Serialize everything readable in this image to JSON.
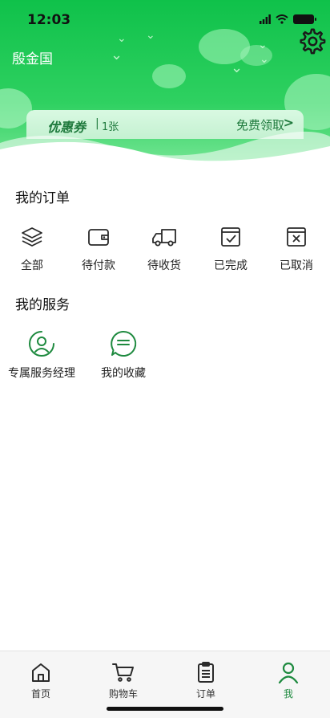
{
  "status_bar": {
    "time": "12:03"
  },
  "header": {
    "username": "殷金国",
    "settings_icon": "gear-icon"
  },
  "coupon": {
    "title": "优惠券",
    "separator": "|",
    "count": "1张",
    "action": "免费领取"
  },
  "orders": {
    "title": "我的订单",
    "items": [
      {
        "label": "全部",
        "icon": "layers-icon"
      },
      {
        "label": "待付款",
        "icon": "wallet-icon"
      },
      {
        "label": "待收货",
        "icon": "truck-icon"
      },
      {
        "label": "已完成",
        "icon": "check-box-icon"
      },
      {
        "label": "已取消",
        "icon": "x-box-icon"
      }
    ]
  },
  "services": {
    "title": "我的服务",
    "items": [
      {
        "label": "专属服务经理",
        "icon": "user-circle-icon"
      },
      {
        "label": "我的收藏",
        "icon": "chat-bubble-icon"
      }
    ]
  },
  "tabbar": {
    "items": [
      {
        "label": "首页",
        "icon": "home-icon"
      },
      {
        "label": "购物车",
        "icon": "cart-icon"
      },
      {
        "label": "订单",
        "icon": "clipboard-icon"
      },
      {
        "label": "我",
        "icon": "person-icon",
        "active": true
      }
    ]
  },
  "colors": {
    "header_green": "#0fc14a",
    "accent": "#1e8a3f",
    "coupon_text": "#1f7a3d"
  }
}
